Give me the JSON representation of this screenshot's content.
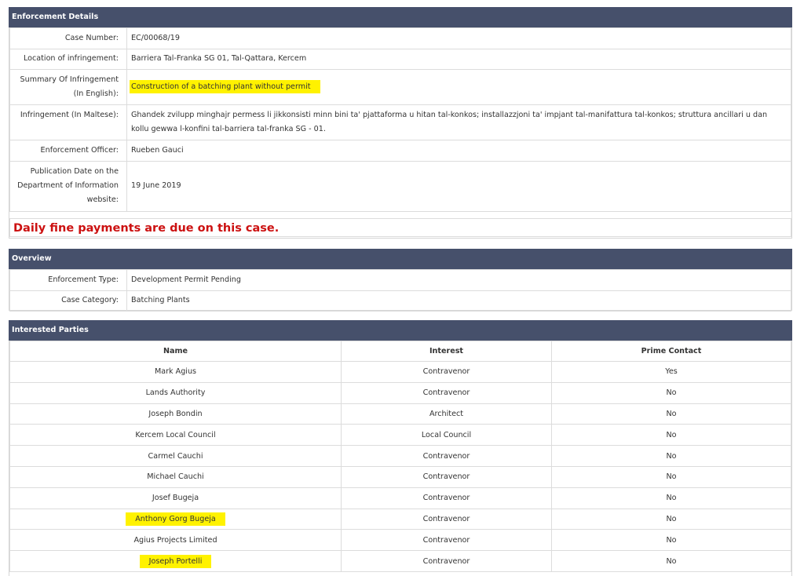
{
  "enforcement": {
    "header": "Enforcement Details",
    "rows": [
      {
        "label": "Case Number:",
        "value": "EC/00068/19"
      },
      {
        "label": "Location of infringement:",
        "value": "Barriera Tal-Franka SG 01, Tal-Qattara, Kercem"
      },
      {
        "label_line1": "Summary Of Infringement",
        "label_line2": "(In English):",
        "value": "Construction of a batching plant without permit"
      },
      {
        "label": "Infringement (In Maltese):",
        "value": "Ghandek zvilupp minghajr permess li jikkonsisti minn bini ta' pjattaforma u hitan tal-konkos; installazzjoni ta' impjant tal-manifattura tal-konkos; struttura ancillari u dan kollu gewwa l-konfini tal-barriera tal-franka SG - 01."
      },
      {
        "label": "Enforcement Officer:",
        "value": "Rueben Gauci"
      },
      {
        "label_line1": "Publication Date on the",
        "label_line2": "Department of Information",
        "label_line3": "website:",
        "value": "19 June 2019"
      }
    ],
    "fine_notice": "Daily fine payments are due on this case."
  },
  "overview": {
    "header": "Overview",
    "rows": [
      {
        "label": "Enforcement Type:",
        "value": "Development Permit Pending"
      },
      {
        "label": "Case Category:",
        "value": "Batching Plants"
      }
    ]
  },
  "parties": {
    "header": "Interested Parties",
    "columns": [
      "Name",
      "Interest",
      "Prime Contact"
    ],
    "rows": [
      {
        "name": "Mark Agius",
        "interest": "Contravenor",
        "prime": "Yes"
      },
      {
        "name": "Lands Authority",
        "interest": "Contravenor",
        "prime": "No"
      },
      {
        "name": "Joseph Bondin",
        "interest": "Architect",
        "prime": "No"
      },
      {
        "name": "Kercem Local Council",
        "interest": "Local Council",
        "prime": "No"
      },
      {
        "name": "Carmel Cauchi",
        "interest": "Contravenor",
        "prime": "No"
      },
      {
        "name": "Michael Cauchi",
        "interest": "Contravenor",
        "prime": "No"
      },
      {
        "name": "Josef Bugeja",
        "interest": "Contravenor",
        "prime": "No"
      },
      {
        "name": "Anthony Gorg Bugeja",
        "interest": "Contravenor",
        "prime": "No"
      },
      {
        "name": "Agius Projects Limited",
        "interest": "Contravenor",
        "prime": "No"
      },
      {
        "name": "Joseph Portelli",
        "interest": "Contravenor",
        "prime": "No"
      }
    ]
  },
  "colors": {
    "header_bg": "#46506b",
    "highlight": "#fff200",
    "fine_text": "#cc1111"
  }
}
